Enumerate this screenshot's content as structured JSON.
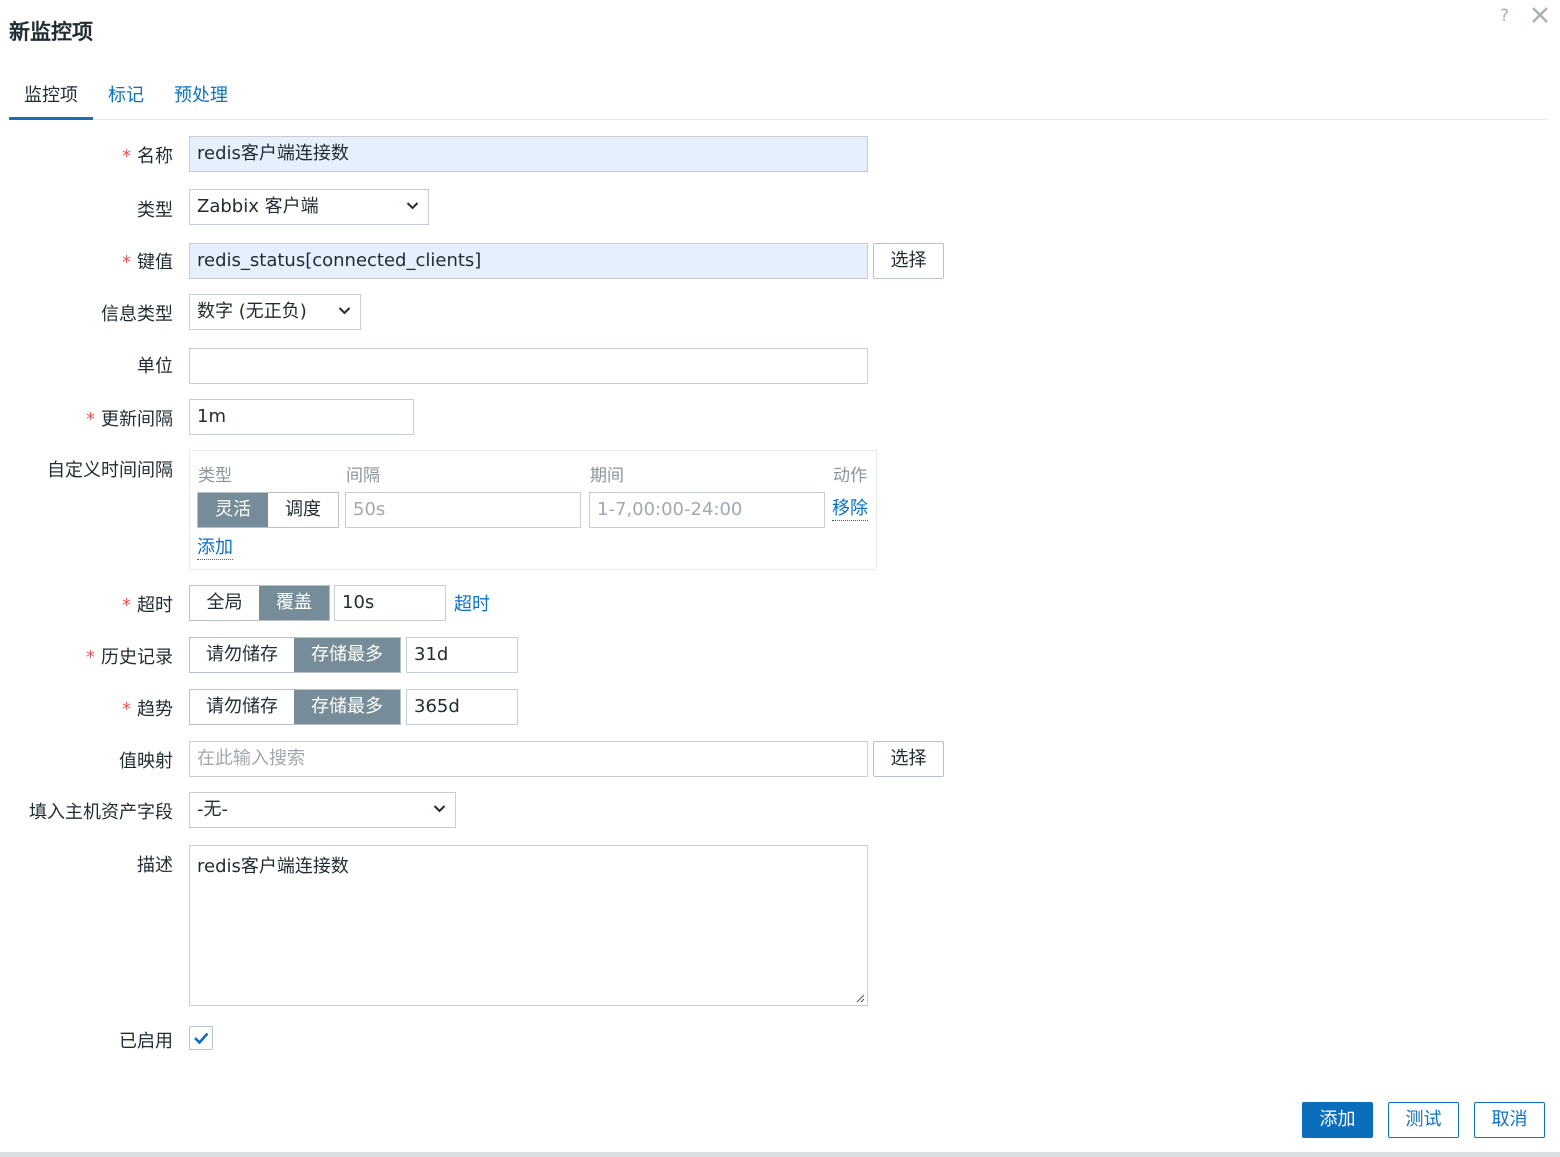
{
  "dialog": {
    "title": "新监控项",
    "help": "?"
  },
  "tabs": [
    {
      "label": "监控项",
      "active": true
    },
    {
      "label": "标记",
      "active": false
    },
    {
      "label": "预处理",
      "active": false
    }
  ],
  "form": {
    "name": {
      "label": "名称",
      "value": "redis客户端连接数",
      "required": "*"
    },
    "type": {
      "label": "类型",
      "value": "Zabbix 客户端"
    },
    "key": {
      "label": "键值",
      "value": "redis_status[connected_clients]",
      "required": "*",
      "select_label": "选择"
    },
    "info_type": {
      "label": "信息类型",
      "value": "数字 (无正负)"
    },
    "units": {
      "label": "单位",
      "value": ""
    },
    "update_interval": {
      "label": "更新间隔",
      "value": "1m",
      "required": "*"
    },
    "custom_intervals": {
      "label": "自定义时间间隔",
      "headers": {
        "type": "类型",
        "interval": "间隔",
        "period": "期间",
        "action": "动作"
      },
      "row": {
        "flexible": "灵活",
        "scheduling": "调度",
        "interval_placeholder": "50s",
        "period_placeholder": "1-7,00:00-24:00",
        "remove": "移除"
      },
      "add": "添加"
    },
    "timeout": {
      "label": "超时",
      "required": "*",
      "global": "全局",
      "override": "覆盖",
      "value": "10s",
      "link": "超时"
    },
    "history": {
      "label": "历史记录",
      "required": "*",
      "no_store": "请勿储存",
      "store_up_to": "存储最多",
      "value": "31d"
    },
    "trends": {
      "label": "趋势",
      "required": "*",
      "no_store": "请勿储存",
      "store_up_to": "存储最多",
      "value": "365d"
    },
    "value_mapping": {
      "label": "值映射",
      "placeholder": "在此输入搜索",
      "select_label": "选择"
    },
    "inventory": {
      "label": "填入主机资产字段",
      "value": "-无-"
    },
    "description": {
      "label": "描述",
      "value": "redis客户端连接数"
    },
    "enabled": {
      "label": "已启用",
      "checked": true
    }
  },
  "footer": {
    "add": "添加",
    "test": "测试",
    "cancel": "取消"
  },
  "colors": {
    "accent": "#0b6ebd",
    "link": "#0b72c6",
    "required": "#e45959",
    "segment_active": "#768d99",
    "highlight": "#e6f0fd"
  }
}
